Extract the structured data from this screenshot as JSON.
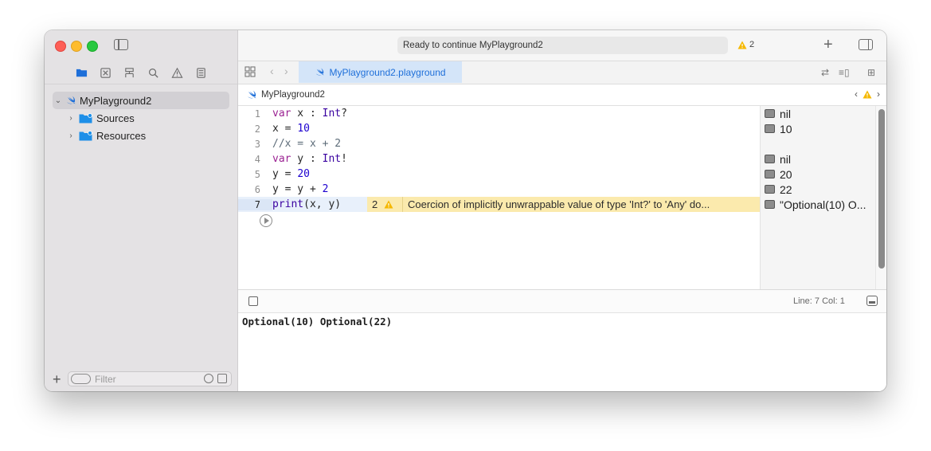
{
  "toolbar": {
    "status": "Ready to continue MyPlayground2",
    "warning_count": "2"
  },
  "sidebar": {
    "root": "MyPlayground2",
    "items": [
      {
        "label": "Sources"
      },
      {
        "label": "Resources"
      }
    ],
    "filter_placeholder": "Filter"
  },
  "tab": {
    "label": "MyPlayground2.playground"
  },
  "jumpbar": {
    "label": "MyPlayground2"
  },
  "editor": {
    "line_numbers": [
      "1",
      "2",
      "3",
      "4",
      "5",
      "6",
      "7"
    ],
    "current_line": 7,
    "inline_warning": {
      "count": "2",
      "message": "Coercion of implicitly unwrappable value of type 'Int?' to 'Any' do..."
    }
  },
  "results": [
    "nil",
    "10",
    "nil",
    "20",
    "22",
    "\"Optional(10) O..."
  ],
  "debug": {
    "position": "Line: 7  Col: 1"
  },
  "console": {
    "output": "Optional(10) Optional(22)"
  },
  "colors": {
    "accent": "#1e6fd9",
    "warning_bg": "#fbeaad",
    "sidebar_bg": "#e4e2e4"
  }
}
